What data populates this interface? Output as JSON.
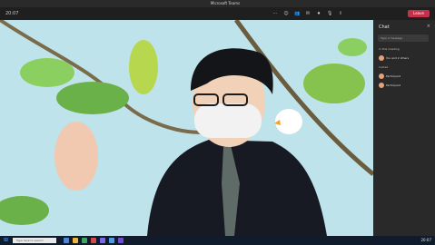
{
  "window": {
    "title": "Microsoft Teams"
  },
  "topbar": {
    "time": "20:07",
    "leave_label": "Leave",
    "controls": [
      "more-icon",
      "react-icon",
      "people-icon",
      "chat-icon",
      "camera-icon",
      "mic-icon",
      "share-icon"
    ]
  },
  "sidebar": {
    "title": "Chat",
    "close_icon": "close-icon",
    "search_placeholder": "Type a message",
    "section_1": "In this meeting",
    "row_1": "You and 2 others",
    "section_2": "Invited",
    "row_2": "Participant",
    "row_3": "Participant"
  },
  "taskbar": {
    "search_placeholder": "Type here to search",
    "clock": "20:07"
  },
  "colors": {
    "leave": "#c4314b",
    "bg": "#bfe3ea"
  }
}
